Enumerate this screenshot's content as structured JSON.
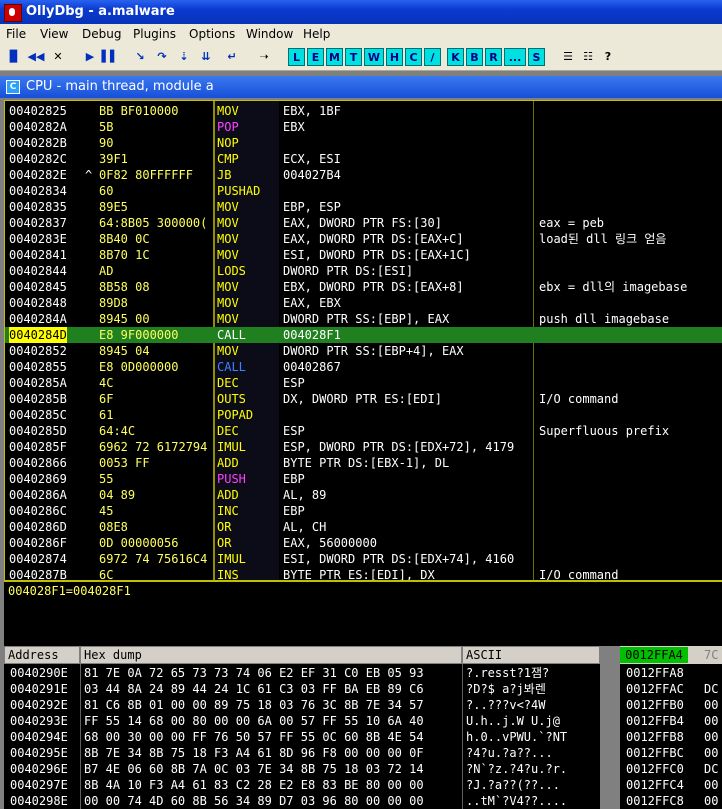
{
  "window": {
    "title": "OllyDbg - a.malware"
  },
  "menu": [
    "File",
    "View",
    "Debug",
    "Plugins",
    "Options",
    "Window",
    "Help"
  ],
  "toolbar": {
    "icons": [
      "open-icon",
      "rewind-icon",
      "close-icon",
      "run-icon",
      "pause-icon",
      "step-into-icon",
      "step-over-icon",
      "trace-into-icon",
      "trace-over-icon",
      "execute-till-return-icon",
      "goto-icon"
    ],
    "icon_glyphs": [
      "▉",
      "◀◀",
      "✕",
      "▶",
      "▌▌",
      "↘",
      "↷",
      "⇣",
      "⇊",
      "↵",
      "➝"
    ],
    "letters": [
      "L",
      "E",
      "M",
      "T",
      "W",
      "H",
      "C",
      "/",
      "K",
      "B",
      "R",
      "...",
      "S"
    ],
    "right_icons": [
      "☰",
      "☷",
      "?"
    ]
  },
  "child": {
    "icon": "C",
    "title": "CPU - main thread, module a"
  },
  "disasm": {
    "rows": [
      {
        "addr": "00402825",
        "jmp": "",
        "hex": "BB BF010000",
        "mn": "MOV",
        "op": "EBX, 1BF",
        "cm": "",
        "mc": "#ffff00"
      },
      {
        "addr": "0040282A",
        "jmp": "",
        "hex": "5B",
        "mn": "POP",
        "op": "EBX",
        "cm": "",
        "mc": "#ff40ff"
      },
      {
        "addr": "0040282B",
        "jmp": "",
        "hex": "90",
        "mn": "NOP",
        "op": "",
        "cm": "",
        "mc": "#ffff00"
      },
      {
        "addr": "0040282C",
        "jmp": "",
        "hex": "39F1",
        "mn": "CMP",
        "op": "ECX, ESI",
        "cm": "",
        "mc": "#ffff00"
      },
      {
        "addr": "0040282E",
        "jmp": "^",
        "hex": "0F82 80FFFFFF",
        "mn": "JB",
        "op": "004027B4",
        "cm": "",
        "mc": "#ffff00"
      },
      {
        "addr": "00402834",
        "jmp": "",
        "hex": "60",
        "mn": "PUSHAD",
        "op": "",
        "cm": "",
        "mc": "#ffff00"
      },
      {
        "addr": "00402835",
        "jmp": "",
        "hex": "89E5",
        "mn": "MOV",
        "op": "EBP, ESP",
        "cm": "",
        "mc": "#ffff00"
      },
      {
        "addr": "00402837",
        "jmp": "",
        "hex": "64:8B05 300000(",
        "mn": "MOV",
        "op": "EAX, DWORD PTR FS:[30]",
        "cm": "eax = peb",
        "mc": "#ffff00"
      },
      {
        "addr": "0040283E",
        "jmp": "",
        "hex": "8B40 0C",
        "mn": "MOV",
        "op": "EAX, DWORD PTR DS:[EAX+C]",
        "cm": "load된 dll 링크 얻음",
        "mc": "#ffff00"
      },
      {
        "addr": "00402841",
        "jmp": "",
        "hex": "8B70 1C",
        "mn": "MOV",
        "op": "ESI, DWORD PTR DS:[EAX+1C]",
        "cm": "",
        "mc": "#ffff00"
      },
      {
        "addr": "00402844",
        "jmp": "",
        "hex": "AD",
        "mn": "LODS",
        "op": "DWORD PTR DS:[ESI]",
        "cm": "",
        "mc": "#ffff00"
      },
      {
        "addr": "00402845",
        "jmp": "",
        "hex": "8B58 08",
        "mn": "MOV",
        "op": "EBX, DWORD PTR DS:[EAX+8]",
        "cm": "ebx = dll의 imagebase",
        "mc": "#ffff00"
      },
      {
        "addr": "00402848",
        "jmp": "",
        "hex": "89D8",
        "mn": "MOV",
        "op": "EAX, EBX",
        "cm": "",
        "mc": "#ffff00"
      },
      {
        "addr": "0040284A",
        "jmp": "",
        "hex": "8945 00",
        "mn": "MOV",
        "op": "DWORD PTR SS:[EBP], EAX",
        "cm": "push dll imagebase",
        "mc": "#ffff00"
      },
      {
        "addr": "0040284D",
        "jmp": "",
        "hex": "E8 9F000000",
        "mn": "CALL",
        "op": "004028F1",
        "cm": "",
        "mc": "#ffffff",
        "sel": true
      },
      {
        "addr": "00402852",
        "jmp": "",
        "hex": "8945 04",
        "mn": "MOV",
        "op": "DWORD PTR SS:[EBP+4], EAX",
        "cm": "",
        "mc": "#ffff00"
      },
      {
        "addr": "00402855",
        "jmp": "",
        "hex": "E8 0D000000",
        "mn": "CALL",
        "op": "00402867",
        "cm": "",
        "mc": "#4080ff"
      },
      {
        "addr": "0040285A",
        "jmp": "",
        "hex": "4C",
        "mn": "DEC",
        "op": "ESP",
        "cm": "",
        "mc": "#ffff00"
      },
      {
        "addr": "0040285B",
        "jmp": "",
        "hex": "6F",
        "mn": "OUTS",
        "op": "DX, DWORD PTR ES:[EDI]",
        "cm": "I/O command",
        "mc": "#ffff00"
      },
      {
        "addr": "0040285C",
        "jmp": "",
        "hex": "61",
        "mn": "POPAD",
        "op": "",
        "cm": "",
        "mc": "#ffff00"
      },
      {
        "addr": "0040285D",
        "jmp": "",
        "hex": "64:4C",
        "mn": "DEC",
        "op": "ESP",
        "cm": "Superfluous prefix",
        "mc": "#ffff00"
      },
      {
        "addr": "0040285F",
        "jmp": "",
        "hex": "6962 72 6172794",
        "mn": "IMUL",
        "op": "ESP, DWORD PTR DS:[EDX+72], 4179",
        "cm": "",
        "mc": "#ffff00"
      },
      {
        "addr": "00402866",
        "jmp": "",
        "hex": "0053 FF",
        "mn": "ADD",
        "op": "BYTE PTR DS:[EBX-1], DL",
        "cm": "",
        "mc": "#ffff00"
      },
      {
        "addr": "00402869",
        "jmp": "",
        "hex": "55",
        "mn": "PUSH",
        "op": "EBP",
        "cm": "",
        "mc": "#ff40ff"
      },
      {
        "addr": "0040286A",
        "jmp": "",
        "hex": "04 89",
        "mn": "ADD",
        "op": "AL, 89",
        "cm": "",
        "mc": "#ffff00"
      },
      {
        "addr": "0040286C",
        "jmp": "",
        "hex": "45",
        "mn": "INC",
        "op": "EBP",
        "cm": "",
        "mc": "#ffff00"
      },
      {
        "addr": "0040286D",
        "jmp": "",
        "hex": "08E8",
        "mn": "OR",
        "op": "AL, CH",
        "cm": "",
        "mc": "#ffff00"
      },
      {
        "addr": "0040286F",
        "jmp": "",
        "hex": "0D 00000056",
        "mn": "OR",
        "op": "EAX, 56000000",
        "cm": "",
        "mc": "#ffff00"
      },
      {
        "addr": "00402874",
        "jmp": "",
        "hex": "6972 74 75616C4",
        "mn": "IMUL",
        "op": "ESI, DWORD PTR DS:[EDX+74], 4160",
        "cm": "",
        "mc": "#ffff00"
      },
      {
        "addr": "0040287B",
        "jmp": "",
        "hex": "6C",
        "mn": "INS",
        "op": "BYTE PTR ES:[EDI], DX",
        "cm": "I/O command",
        "mc": "#ffff00"
      }
    ]
  },
  "info": {
    "text": "004028F1=004028F1"
  },
  "dump": {
    "headers": {
      "address": "Address",
      "hex": "Hex dump",
      "ascii": "ASCII"
    },
    "rows": [
      {
        "a": "0040290E",
        "h": "81 7E 0A 72 65 73 73 74 06 E2 EF 31 C0 EB 05 93",
        "s": "?.resst\u0006?1잼?"
      },
      {
        "a": "0040291E",
        "h": "03 44 8A 24 89 44 24 1C 61 C3 03 FF BA EB 89 C6",
        "s": "?D?$ a?j봐렌"
      },
      {
        "a": "0040292E",
        "h": "81 C6 8B 01 00 00 89 75 18 03 76 3C 8B 7E 34 57",
        "s": "?..???v<?4W"
      },
      {
        "a": "0040293E",
        "h": "FF 55 14 68 00 80 00 00 6A 00 57 FF 55 10 6A 40",
        "s": "U.h..j.W U.j@"
      },
      {
        "a": "0040294E",
        "h": "68 00 30 00 00 FF 76 50 57 FF 55 0C 60 8B 4E 54",
        "s": "h.0..vPWU.`?NT"
      },
      {
        "a": "0040295E",
        "h": "8B 7E 34 8B 75 18 F3 A4 61 8D 96 F8 00 00 00 0F",
        "s": "?4?u.?a??..."
      },
      {
        "a": "0040296E",
        "h": "B7 4E 06 60 8B 7A 0C 03 7E 34 8B 75 18 03 72 14",
        "s": "?N`?z.?4?u.?r."
      },
      {
        "a": "0040297E",
        "h": "8B 4A 10 F3 A4 61 83 C2 28 E2 E8 83 BE 80 00 00",
        "s": "?J.?a??(??..."
      },
      {
        "a": "0040298E",
        "h": "00 00 74 4D 60 8B 56 34 89 D7 03 96 80 00 00 00",
        "s": "..tM`?V4??...."
      }
    ]
  },
  "stack": {
    "current": "0012FFA4",
    "next": "7C",
    "rows": [
      {
        "a": "0012FFA8",
        "v": ""
      },
      {
        "a": "0012FFAC",
        "v": "DC"
      },
      {
        "a": "0012FFB0",
        "v": "00"
      },
      {
        "a": "0012FFB4",
        "v": "00"
      },
      {
        "a": "0012FFB8",
        "v": "00"
      },
      {
        "a": "0012FFBC",
        "v": "00"
      },
      {
        "a": "0012FFC0",
        "v": "DC"
      },
      {
        "a": "0012FFC4",
        "v": "00"
      },
      {
        "a": "0012FFC8",
        "v": "00"
      }
    ]
  }
}
